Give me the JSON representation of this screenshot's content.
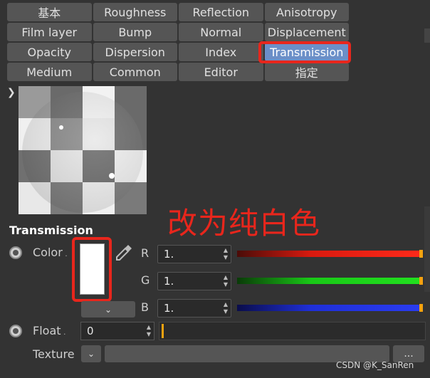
{
  "tabs": [
    [
      "基本",
      "Roughness",
      "Reflection",
      "Anisotropy"
    ],
    [
      "Film layer",
      "Bump",
      "Normal",
      "Displacement"
    ],
    [
      "Opacity",
      "Dispersion",
      "Index",
      "Transmission"
    ],
    [
      "Medium",
      "Common",
      "Editor",
      "指定"
    ]
  ],
  "active_tab": "Transmission",
  "annotation": "改为纯白色",
  "section": {
    "title": "Transmission",
    "color_label": "Color",
    "color_value": "#ffffff",
    "channels": [
      {
        "label": "R",
        "value": "1.",
        "slider_color": "#d91a0f"
      },
      {
        "label": "G",
        "value": "1.",
        "slider_color": "#19c817"
      },
      {
        "label": "B",
        "value": "1.",
        "slider_color": "#1f2fd8"
      }
    ],
    "float_label": "Float",
    "float_value": "0",
    "texture_label": "Texture",
    "texture_more": "..."
  },
  "colors": {
    "accent": "#6b8fc8",
    "highlight": "#e8261c",
    "knob": "#f4a20f"
  },
  "watermark": "CSDN @K_SanRen"
}
